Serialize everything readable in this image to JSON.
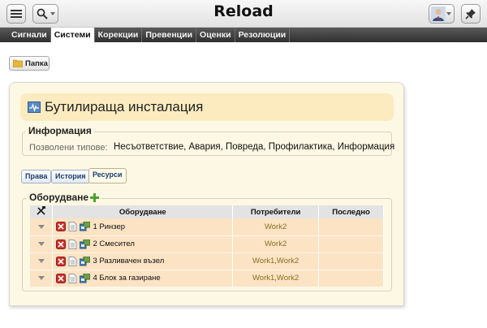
{
  "app": {
    "title": "Reload"
  },
  "topbar": {
    "menu_icon": "menu-icon",
    "search_icon": "search-icon",
    "user_icon": "avatar",
    "pin_icon": "pin-icon"
  },
  "tabs": [
    {
      "label": "Сигнали",
      "active": false
    },
    {
      "label": "Системи",
      "active": true
    },
    {
      "label": "Корекции",
      "active": false
    },
    {
      "label": "Превенции",
      "active": false
    },
    {
      "label": "Оценки",
      "active": false
    },
    {
      "label": "Резолюции",
      "active": false
    }
  ],
  "folder": {
    "label": "Папка"
  },
  "page": {
    "title": "Бутилираща инсталация"
  },
  "info": {
    "legend": "Информация",
    "label": "Позволени типове:",
    "value": "Несъответствие, Авария, Повреда, Профилактика, Информация"
  },
  "subtabs": [
    {
      "label": "Права",
      "active": false
    },
    {
      "label": "История",
      "active": false
    },
    {
      "label": "Ресурси",
      "active": true
    }
  ],
  "equipment": {
    "legend": "Оборудване",
    "headers": {
      "tool": "",
      "equipment": "Оборудване",
      "users": "Потребители",
      "last": "Последно"
    },
    "rows": [
      {
        "name": "1 Ринзер",
        "users": [
          "Work2"
        ],
        "last": ""
      },
      {
        "name": "2 Смесител",
        "users": [
          "Work2"
        ],
        "last": ""
      },
      {
        "name": "3 Разливачен възел",
        "users": [
          "Work1",
          "Work2"
        ],
        "last": ""
      },
      {
        "name": "4 Блок за газиране",
        "users": [
          "Work1",
          "Work2"
        ],
        "last": ""
      }
    ]
  },
  "colors": {
    "panel_bg": "#fdf8e3",
    "title_bg": "#fbebbf",
    "row_bg": "#fbe3c4",
    "link": "#8a6d1f",
    "tab_bar": "#2f2f2f"
  }
}
